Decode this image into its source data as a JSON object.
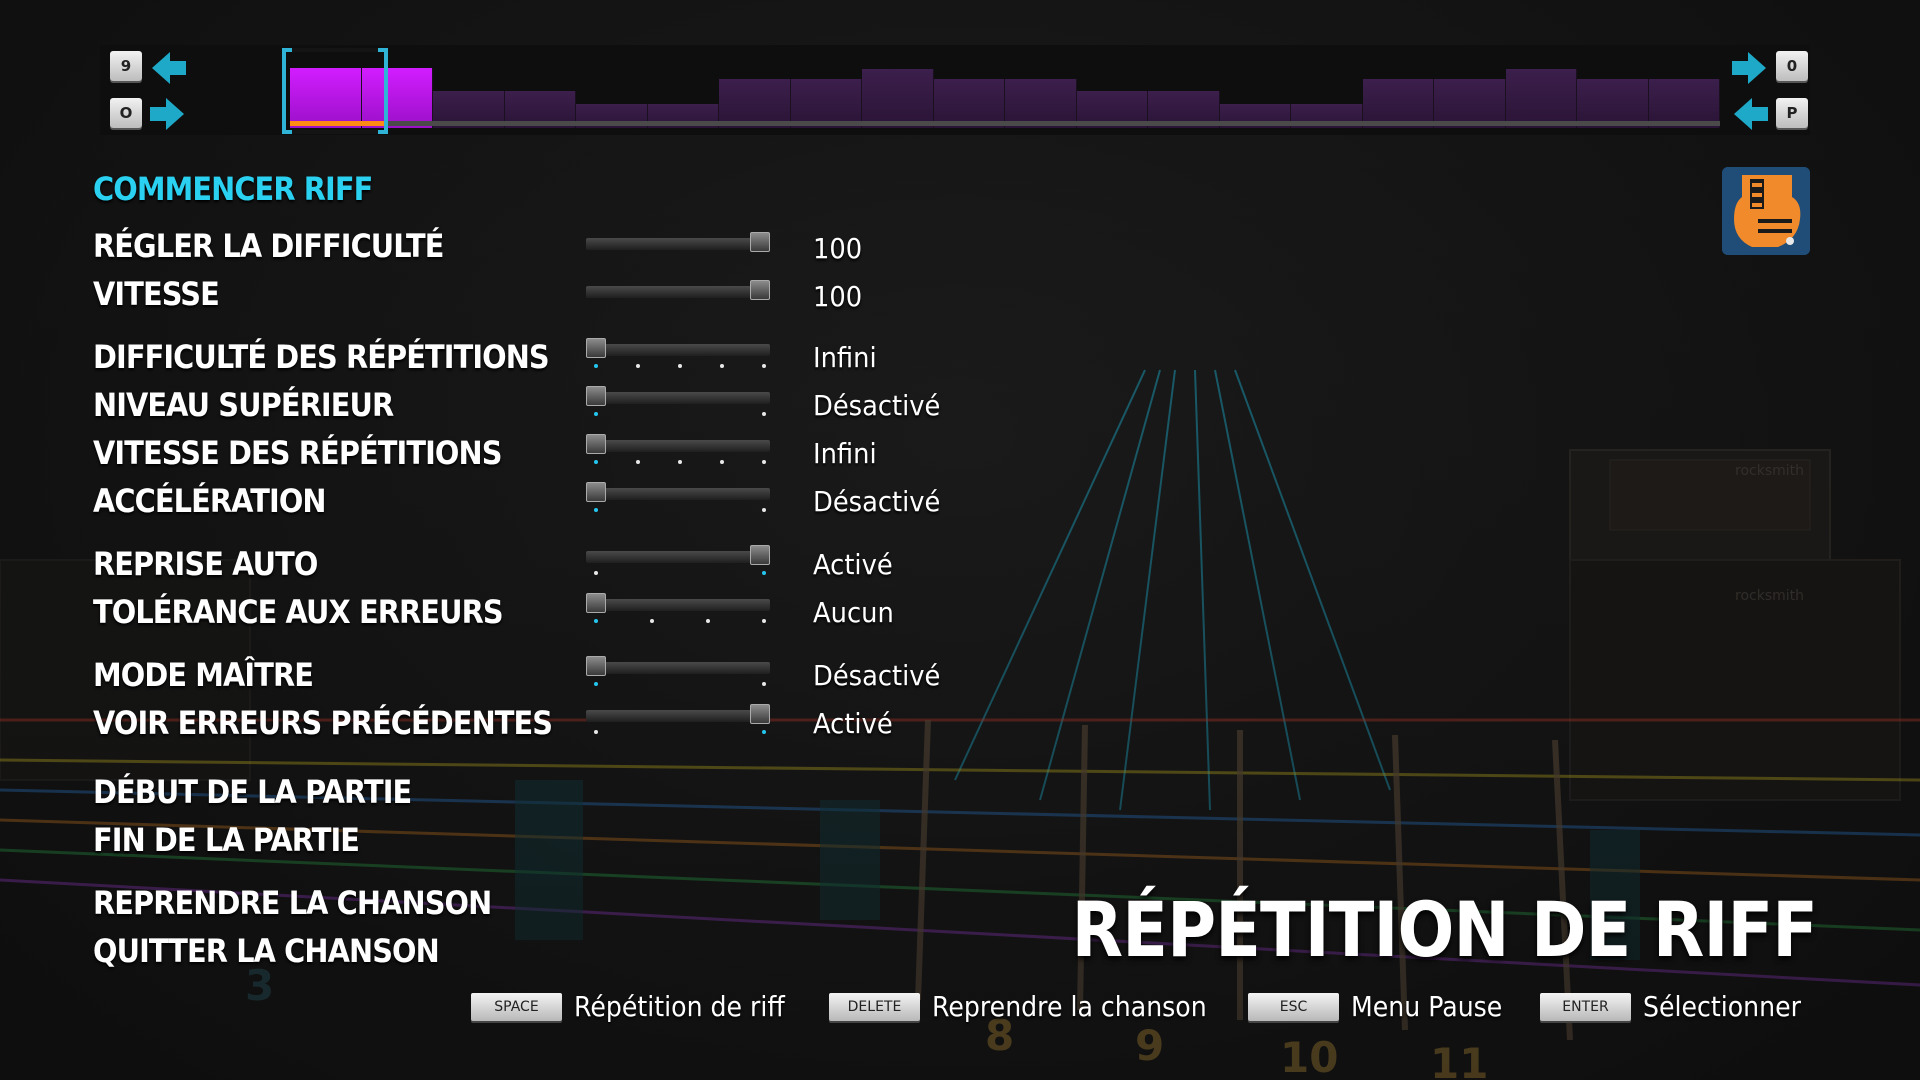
{
  "screen_title": "RÉPÉTITION DE RIFF",
  "colors": {
    "accent": "#2ad1f0",
    "segment": "#3c1f4c",
    "segment_selected": "#d21dff",
    "selection_bracket": "#2fb3d6",
    "selection_bar": "#ff8a14"
  },
  "timeline": {
    "key_left_top": "9",
    "key_left_bottom": "O",
    "key_right_top": "0",
    "key_right_bottom": "P",
    "segment_levels": [
      0.6,
      0.6,
      0.38,
      0.38,
      0.24,
      0.24,
      0.5,
      0.5,
      0.6,
      0.5,
      0.5,
      0.38,
      0.38,
      0.24,
      0.24,
      0.5,
      0.5,
      0.6,
      0.5,
      0.5
    ],
    "selected_segments": [
      0,
      1
    ]
  },
  "menu": {
    "start_riff": "COMMENCER RIFF",
    "difficulty": "RÉGLER LA DIFFICULTÉ",
    "speed": "VITESSE",
    "rep_difficulty": "DIFFICULTÉ DES RÉPÉTITIONS",
    "level_up": "NIVEAU SUPÉRIEUR",
    "rep_speed": "VITESSE DES RÉPÉTITIONS",
    "acceleration": "ACCÉLÉRATION",
    "auto_restart": "REPRISE AUTO",
    "error_tolerance": "TOLÉRANCE AUX ERREURS",
    "master_mode": "MODE MAÎTRE",
    "show_prev_errors": "VOIR ERREURS PRÉCÉDENTES",
    "section_start": "DÉBUT DE LA PARTIE",
    "section_end": "FIN DE LA PARTIE",
    "resume_song": "REPRENDRE LA CHANSON",
    "quit_song": "QUITTER LA CHANSON"
  },
  "settings": {
    "difficulty": {
      "value": "100",
      "level": 1.0
    },
    "speed": {
      "value": "100",
      "level": 1.0
    },
    "rep_difficulty": {
      "value": "Infini",
      "level": 0.0
    },
    "level_up": {
      "value": "Désactivé",
      "level": 0.0
    },
    "rep_speed": {
      "value": "Infini",
      "level": 0.0
    },
    "acceleration": {
      "value": "Désactivé",
      "level": 0.0
    },
    "auto_restart": {
      "value": "Activé",
      "level": 1.0
    },
    "error_tolerance": {
      "value": "Aucun",
      "level": 0.0
    },
    "master_mode": {
      "value": "Désactivé",
      "level": 0.0
    },
    "show_prev_errors": {
      "value": "Activé",
      "level": 1.0
    }
  },
  "footer": {
    "space_key": "SPACE",
    "space_label": "Répétition de riff",
    "delete_key": "DELETE",
    "delete_label": "Reprendre la chanson",
    "esc_key": "ESC",
    "esc_label": "Menu Pause",
    "enter_key": "ENTER",
    "enter_label": "Sélectionner"
  },
  "background": {
    "fret_numbers": [
      "8",
      "9",
      "10",
      "11",
      "3"
    ],
    "amp_brand": "rocksmith"
  },
  "icons": {
    "prev_section": "arrow-left-icon",
    "next_section": "arrow-right-icon",
    "instrument": "guitar-icon"
  }
}
